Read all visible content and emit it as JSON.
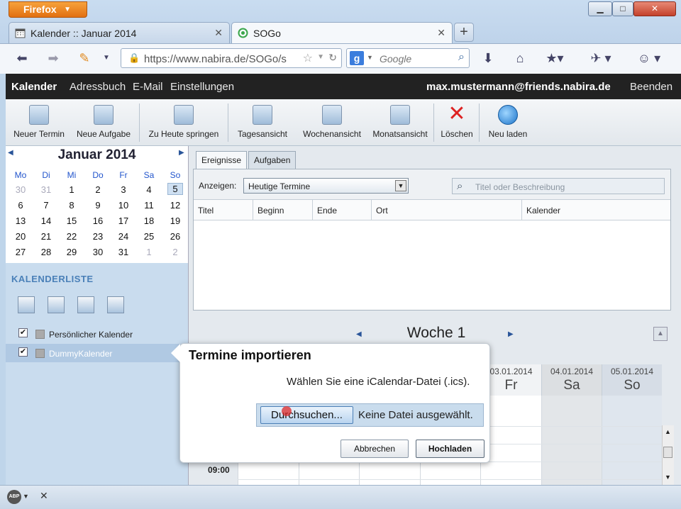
{
  "browser": {
    "menu_label": "Firefox",
    "tabs": [
      {
        "label": "Kalender :: Januar 2014",
        "active": false
      },
      {
        "label": "SOGo",
        "active": true
      }
    ],
    "url": "https://www.nabira.de/SOGo/s",
    "search_engine": "Google",
    "search_placeholder": "Google"
  },
  "app": {
    "nav": [
      "Kalender",
      "Adressbuch",
      "E-Mail",
      "Einstellungen"
    ],
    "user": "max.mustermann@friends.nabira.de",
    "logout": "Beenden"
  },
  "toolbar": [
    {
      "label": "Neuer Termin",
      "icon": "new-event-icon"
    },
    {
      "label": "Neue Aufgabe",
      "icon": "new-task-icon"
    },
    {
      "label": "Zu Heute springen",
      "icon": "go-today-icon"
    },
    {
      "label": "Tagesansicht",
      "icon": "day-view-icon"
    },
    {
      "label": "Wochenansicht",
      "icon": "week-view-icon"
    },
    {
      "label": "Monatsansicht",
      "icon": "month-view-icon"
    },
    {
      "label": "Löschen",
      "icon": "delete-icon"
    },
    {
      "label": "Neu laden",
      "icon": "reload-icon"
    }
  ],
  "minical": {
    "month": "Januar",
    "year": "2014",
    "weekdays": [
      "Mo",
      "Di",
      "Mi",
      "Do",
      "Fr",
      "Sa",
      "So"
    ],
    "weeks": [
      [
        "30",
        "31",
        "1",
        "2",
        "3",
        "4",
        "5"
      ],
      [
        "6",
        "7",
        "8",
        "9",
        "10",
        "11",
        "12"
      ],
      [
        "13",
        "14",
        "15",
        "16",
        "17",
        "18",
        "19"
      ],
      [
        "20",
        "21",
        "22",
        "23",
        "24",
        "25",
        "26"
      ],
      [
        "27",
        "28",
        "29",
        "30",
        "31",
        "1",
        "2"
      ]
    ],
    "today": "5"
  },
  "calendarlist": {
    "header": "KALENDERLISTE",
    "items": [
      {
        "label": "Persönlicher Kalender",
        "checked": true,
        "color": "#aaaaaa"
      },
      {
        "label": "DummyKalender",
        "checked": true,
        "color": "#aaaaaa"
      }
    ]
  },
  "events": {
    "tabs": [
      "Ereignisse",
      "Aufgaben"
    ],
    "show_label": "Anzeigen:",
    "show_value": "Heutige Termine",
    "search_placeholder": "Titel oder Beschreibung",
    "columns": [
      "Titel",
      "Beginn",
      "Ende",
      "Ort",
      "Kalender"
    ]
  },
  "week": {
    "title": "Woche 1",
    "days": [
      {
        "date": "03.01.2014",
        "name": "Fr"
      },
      {
        "date": "04.01.2014",
        "name": "Sa"
      },
      {
        "date": "05.01.2014",
        "name": "So"
      }
    ],
    "hour_label": "09:00"
  },
  "dialog": {
    "title": "Termine importieren",
    "text": "Wählen Sie eine iCalendar-Datei (.ics).",
    "browse": "Durchsuchen...",
    "nofile": "Keine Datei ausgewählt.",
    "cancel": "Abbrechen",
    "upload": "Hochladen"
  },
  "status": {
    "adblock": "ABP"
  }
}
